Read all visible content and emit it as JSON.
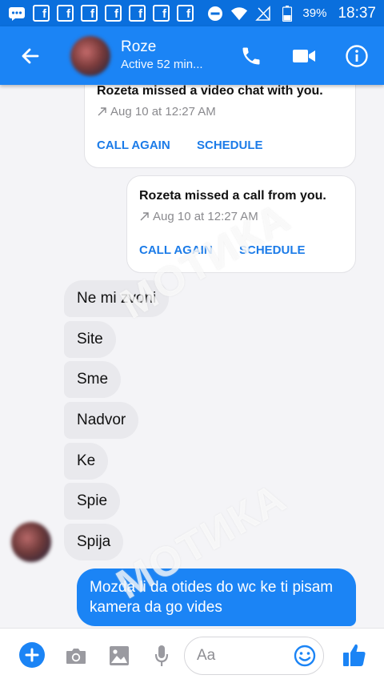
{
  "status_bar": {
    "battery": "39%",
    "time": "18:37"
  },
  "header": {
    "contact_name": "Roze",
    "status": "Active 52 min..."
  },
  "cards": [
    {
      "title": "Rozeta missed a video chat with you.",
      "time": "Aug 10 at 12:27 AM",
      "action_primary": "CALL AGAIN",
      "action_secondary": "SCHEDULE"
    },
    {
      "title": "Rozeta missed a call from you.",
      "time": "Aug 10 at 12:27 AM",
      "action_primary": "CALL AGAIN",
      "action_secondary": "SCHEDULE"
    }
  ],
  "incoming": [
    "Ne mi zvoni",
    "Site",
    "Sme",
    "Nadvor",
    "Ke",
    "Spie",
    "Spija"
  ],
  "outgoing": [
    "Mozda li da otides do wc ke ti pisam kamera da go vides"
  ],
  "watermark": "МОТИКА",
  "composer": {
    "placeholder": "Aa"
  },
  "colors": {
    "brand": "#1b84f5",
    "status_bar": "#0a6fdd",
    "action_text": "#1b7be8",
    "incoming_bubble": "#e9e9ed"
  }
}
